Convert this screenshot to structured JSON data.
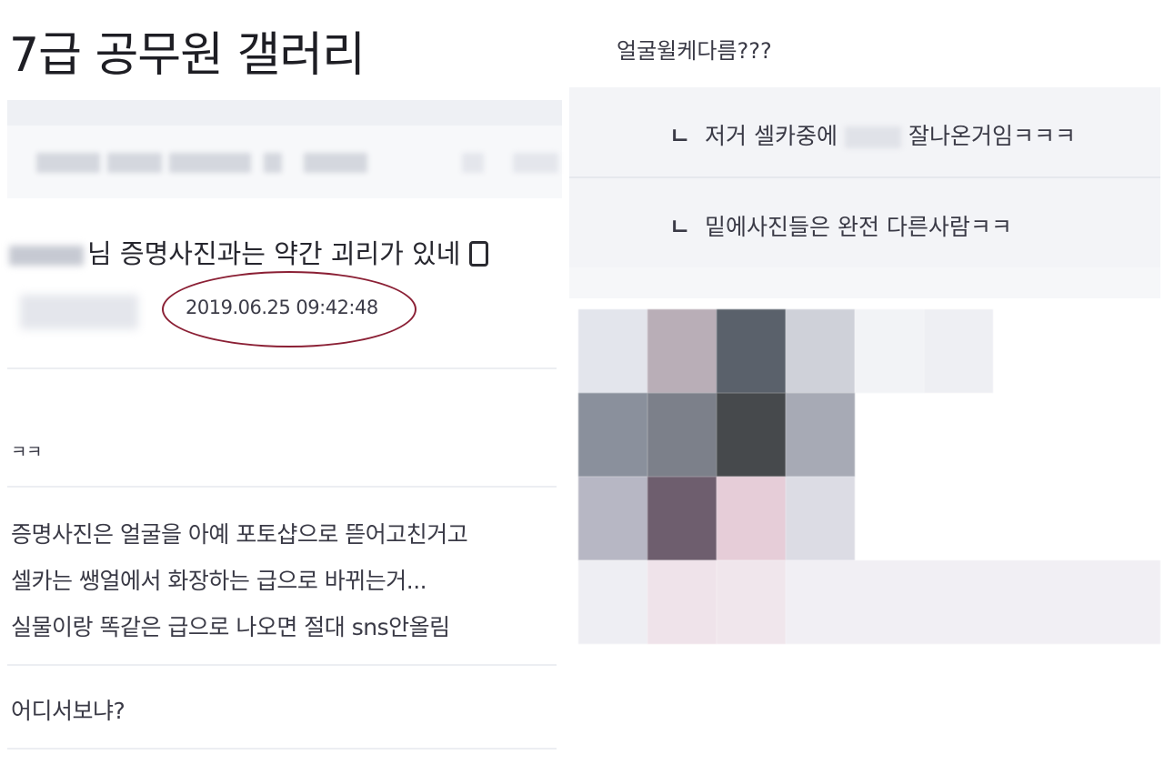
{
  "gallery_title": "7급 공무원 갤러리",
  "post": {
    "title_suffix": "님 증명사진과는 약간 괴리가 있네",
    "datetime": "2019.06.25 09:42:48"
  },
  "left_comments": [
    "ㅋㅋ",
    "증명사진은 얼굴을 아예 포토샵으로 뜯어고친거고",
    "셀카는 쌩얼에서 화장하는 급으로 바뀌는거...",
    "실물이랑 똑같은 급으로 나오면 절대 sns안올림",
    "어디서보냐?"
  ],
  "right_comment": "얼굴윌케다름???",
  "replies": [
    {
      "marker": "ㄴ",
      "before": "저거 셀카중에",
      "after": "잘나온거임ㅋㅋㅋ"
    },
    {
      "marker": "ㄴ",
      "before": "밑에사진들은 완전 다른사람ㅋㅋ",
      "after": ""
    }
  ],
  "highlight_color": "#8b2035",
  "icons": {
    "device": "mobile-phone-icon"
  }
}
